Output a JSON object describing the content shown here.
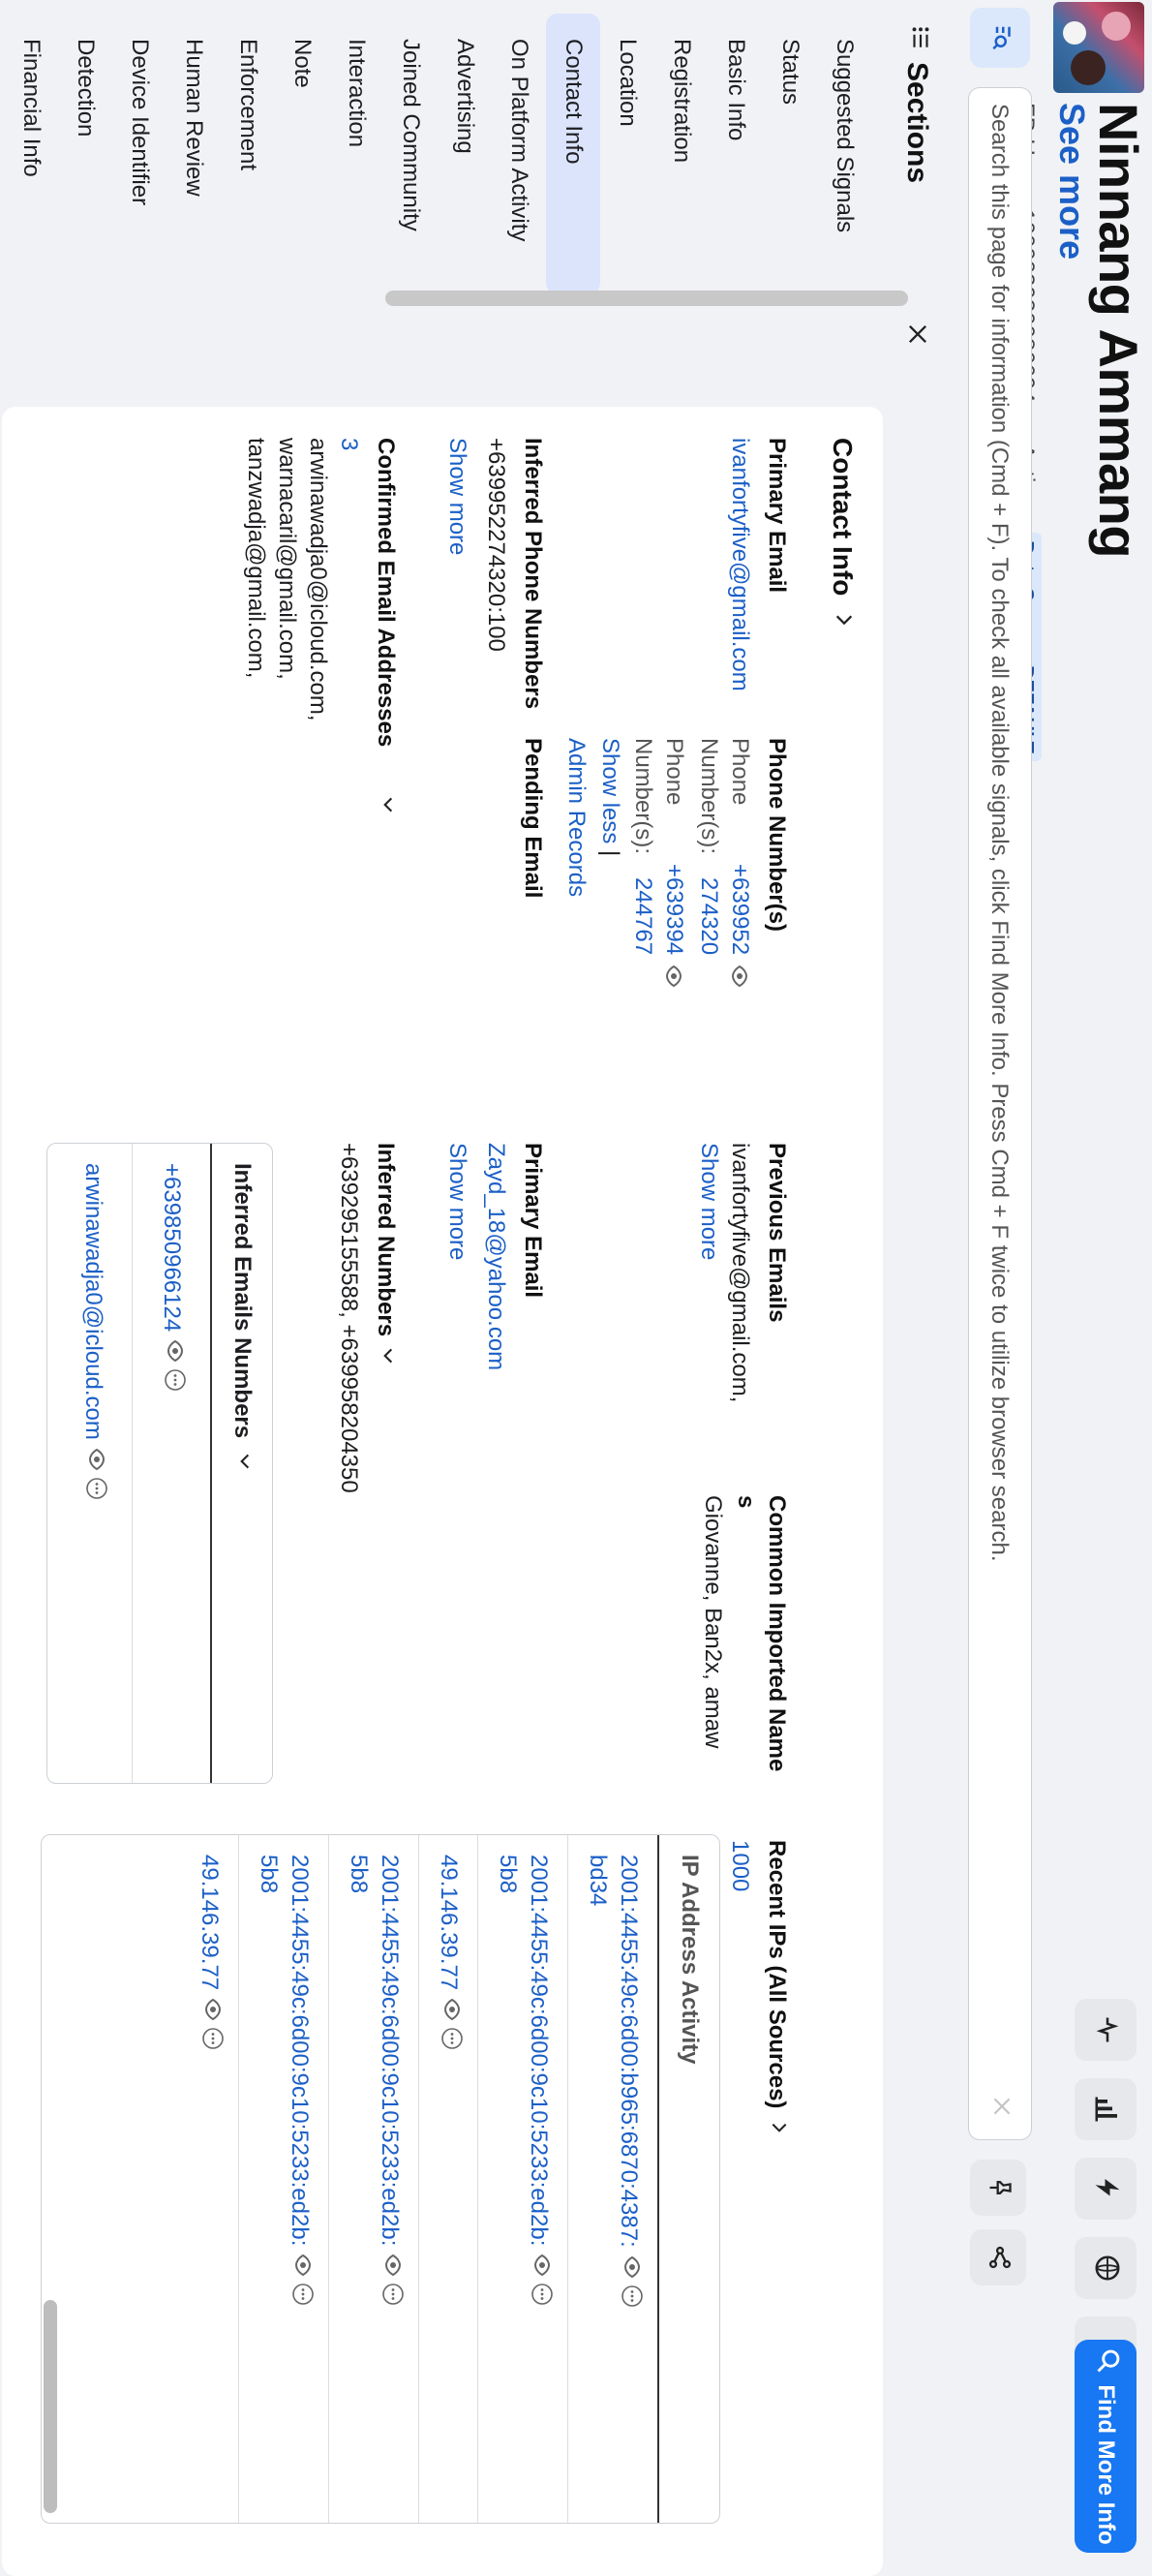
{
  "profile": {
    "name": "Ninnang Ammang",
    "see_more": "See more",
    "meta_user": "FB User · 100003930086694 ·",
    "meta_status": "Active ·",
    "data_source": "Data Source: DEFAULT"
  },
  "header": {
    "find_more_label": "Find More Info",
    "buttons": [
      "activity-icon",
      "chart-icon",
      "bolt-icon",
      "globe-icon",
      "caret-icon"
    ]
  },
  "search": {
    "placeholder": "Search this page for information (Cmd + F). To check all available signals, click Find More Info. Press Cmd + F twice to utilize browser search."
  },
  "sidebar": {
    "title": "Sections",
    "items": [
      {
        "label": "Suggested Signals"
      },
      {
        "label": "Status"
      },
      {
        "label": "Basic Info"
      },
      {
        "label": "Registration"
      },
      {
        "label": "Location"
      },
      {
        "label": "Contact Info",
        "active": true
      },
      {
        "label": "On Platform Activity"
      },
      {
        "label": "Advertising"
      },
      {
        "label": "Joined Community"
      },
      {
        "label": "Interaction"
      },
      {
        "label": "Note"
      },
      {
        "label": "Enforcement"
      },
      {
        "label": "Human Review"
      },
      {
        "label": "Device Identifier"
      },
      {
        "label": "Detection"
      },
      {
        "label": "Financial Info"
      }
    ]
  },
  "contact": {
    "title": "Contact Info",
    "primary_email": {
      "label": "Primary Email",
      "value": "ivanfortyfive@gmail.com"
    },
    "phone_numbers": {
      "label": "Phone Number(s)",
      "row1_l1": "Phone",
      "row1_l2": "Number(s):",
      "row1_v1": "+639952",
      "row1_v2": "274320",
      "row2_l1": "Phone",
      "row2_l2": "Number(s):",
      "row2_v1": "+639394",
      "row2_v2": "244767",
      "show_less": "Show less",
      "separator": " |",
      "admin_records": "Admin Records"
    },
    "previous_emails": {
      "label": "Previous Emails",
      "value": "ivanfortyfive@gmail.com,",
      "show_more": "Show more"
    },
    "common_imported_name": {
      "label_a": "Common Imported Name",
      "label_b": "s",
      "value": "Giovanne, Ban2x, amaw"
    },
    "recent_ips": {
      "label": "Recent IPs (All Sources)",
      "value": "1000"
    },
    "inferred_phone_numbers": {
      "label": "Inferred Phone Numbers",
      "value": "+639952274320:100",
      "show_more": "Show more"
    },
    "pending_email": {
      "label": "Pending Email"
    },
    "primary_email_2": {
      "label": "Primary Email",
      "value": "Zayd_18@yahoo.com",
      "show_more": "Show more"
    },
    "confirmed_emails": {
      "label": "Confirmed Email Addresses",
      "count": "3",
      "values": [
        "arwinawadja0@icloud.com,",
        "warnacaril@gmail.com,",
        "tanzwadja@gmail.com,"
      ]
    },
    "inferred_numbers": {
      "label": "Inferred Numbers",
      "value": "+639295155588, +639958204350"
    },
    "inferred_emails_numbers": {
      "label": "Inferred Emails Numbers",
      "rows": [
        "+639850966124",
        "arwinawadja0@icloud.com"
      ]
    },
    "ip_activity": {
      "label": "IP Address Activity",
      "rows": [
        {
          "l1": "2001:4455:49c:6d00:b965:6870:4387:",
          "l2": "bd34"
        },
        {
          "l1": "2001:4455:49c:6d00:9c10:5233:ed2b:",
          "l2": "5b8"
        },
        {
          "l1": "49.146.39.77",
          "l2": ""
        },
        {
          "l1": "2001:4455:49c:6d00:9c10:5233:ed2b:",
          "l2": "5b8"
        },
        {
          "l1": "2001:4455:49c:6d00:9c10:5233:ed2b:",
          "l2": "5b8"
        },
        {
          "l1": "49.146.39.77",
          "l2": ""
        }
      ]
    }
  }
}
